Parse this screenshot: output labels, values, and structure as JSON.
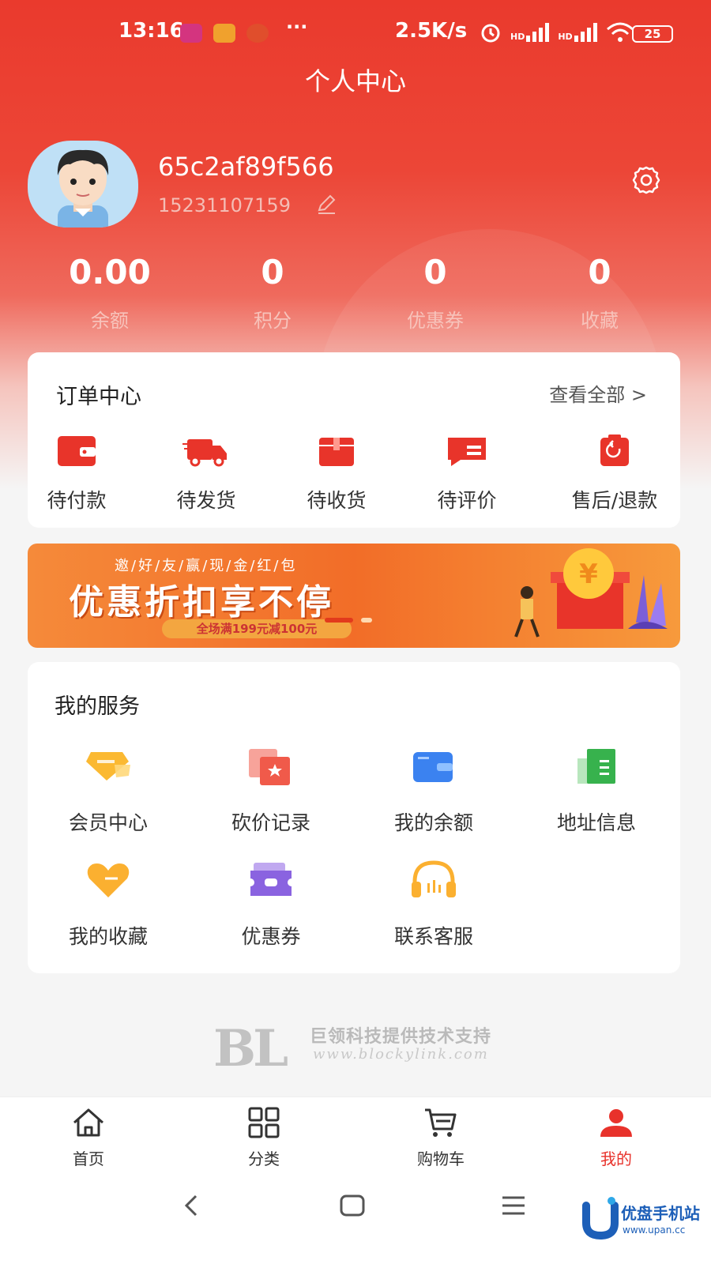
{
  "status_bar": {
    "time": "13:16",
    "dots": "···",
    "network_speed": "2.5K/s",
    "signal_1": "HD",
    "signal_2": "HD",
    "battery": "25"
  },
  "header": {
    "title": "个人中心"
  },
  "profile": {
    "username": "65c2af89f566",
    "phone": "15231107159"
  },
  "stats": [
    {
      "value": "0.00",
      "label": "余额"
    },
    {
      "value": "0",
      "label": "积分"
    },
    {
      "value": "0",
      "label": "优惠券"
    },
    {
      "value": "0",
      "label": "收藏"
    }
  ],
  "orders": {
    "title": "订单中心",
    "view_all": "查看全部 >",
    "items": [
      {
        "label": "待付款",
        "icon": "wallet-icon"
      },
      {
        "label": "待发货",
        "icon": "truck-icon"
      },
      {
        "label": "待收货",
        "icon": "package-icon"
      },
      {
        "label": "待评价",
        "icon": "review-icon"
      },
      {
        "label": "售后/退款",
        "icon": "refund-icon"
      }
    ]
  },
  "banner": {
    "subtitle": "邀/好/友/赢/现/金/红/包",
    "title": "优惠折扣享不停",
    "note": "全场满199元减100元"
  },
  "services": {
    "title": "我的服务",
    "items": [
      {
        "label": "会员中心",
        "icon": "vip-diamond-icon"
      },
      {
        "label": "砍价记录",
        "icon": "bargain-icon"
      },
      {
        "label": "我的余额",
        "icon": "balance-card-icon"
      },
      {
        "label": "地址信息",
        "icon": "address-book-icon"
      },
      {
        "label": "我的收藏",
        "icon": "heart-icon"
      },
      {
        "label": "优惠券",
        "icon": "ticket-icon"
      },
      {
        "label": "联系客服",
        "icon": "headset-icon"
      }
    ]
  },
  "watermark": {
    "logo": "BL",
    "text": "巨领科技提供技术支持",
    "url": "www.blockylink.com"
  },
  "tabbar": {
    "items": [
      {
        "label": "首页",
        "icon": "home-icon"
      },
      {
        "label": "分类",
        "icon": "grid-icon"
      },
      {
        "label": "购物车",
        "icon": "cart-icon"
      },
      {
        "label": "我的",
        "icon": "user-icon"
      }
    ],
    "active": "我的",
    "active_color": "#e8322b"
  },
  "corner_badge": {
    "text": "优盘手机站",
    "url": "www.upan.cc"
  },
  "colors": {
    "brand_red": "#ea3a2d",
    "banner_orange": "#f26d28"
  }
}
